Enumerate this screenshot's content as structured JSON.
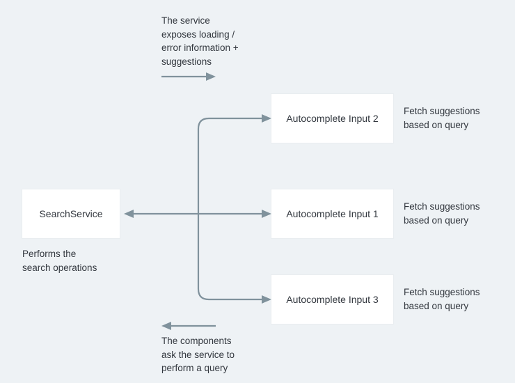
{
  "service": {
    "label": "SearchService",
    "caption": "Performs the\nsearch operations"
  },
  "inputs": [
    {
      "label": "Autocomplete Input 2",
      "caption": "Fetch suggestions\nbased on query"
    },
    {
      "label": "Autocomplete Input 1",
      "caption": "Fetch suggestions\nbased on query"
    },
    {
      "label": "Autocomplete Input 3",
      "caption": "Fetch suggestions\nbased on query"
    }
  ],
  "annotations": {
    "top": "The service\nexposes loading /\nerror information +\nsuggestions",
    "bottom": "The components\nask the service to\nperform a query"
  }
}
